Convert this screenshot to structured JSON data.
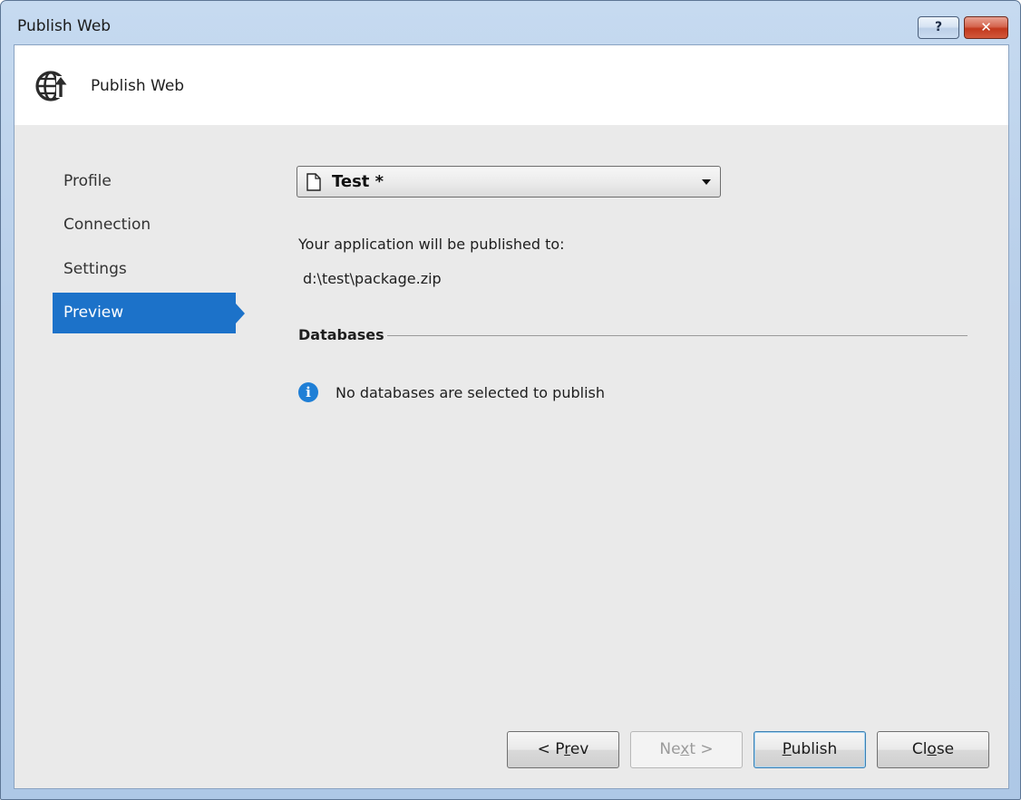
{
  "window": {
    "title": "Publish Web",
    "help_label": "?",
    "close_label": "✕"
  },
  "header": {
    "title": "Publish Web",
    "icon": "globe-publish-icon"
  },
  "nav": {
    "items": [
      {
        "label": "Profile",
        "active": false
      },
      {
        "label": "Connection",
        "active": false
      },
      {
        "label": "Settings",
        "active": false
      },
      {
        "label": "Preview",
        "active": true
      }
    ]
  },
  "profile": {
    "selected": "Test *",
    "icon": "document-icon"
  },
  "preview": {
    "publish_to_label": "Your application will be published to:",
    "publish_path": "d:\\test\\package.zip",
    "databases_title": "Databases",
    "databases_message": "No databases are selected to publish",
    "info_icon": "info-icon"
  },
  "buttons": {
    "prev": {
      "pre": "< P",
      "accel": "r",
      "post": "ev",
      "enabled": true
    },
    "next": {
      "pre": "Ne",
      "accel": "x",
      "post": "t >",
      "enabled": false
    },
    "publish": {
      "pre": "",
      "accel": "P",
      "post": "ublish",
      "enabled": true
    },
    "close": {
      "pre": "Cl",
      "accel": "o",
      "post": "se",
      "enabled": true
    }
  },
  "colors": {
    "accent": "#1c72c9",
    "info": "#1f7fd6",
    "close_button": "#c2381d"
  }
}
